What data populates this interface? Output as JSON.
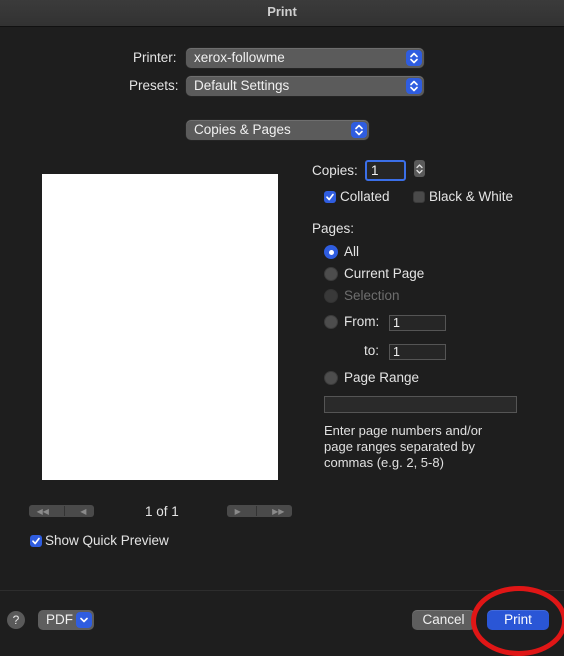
{
  "window": {
    "title": "Print"
  },
  "printer": {
    "label": "Printer:",
    "value": "xerox-followme"
  },
  "presets": {
    "label": "Presets:",
    "value": "Default Settings"
  },
  "section": {
    "value": "Copies & Pages"
  },
  "copies": {
    "label": "Copies:",
    "value": "1"
  },
  "collated": {
    "label": "Collated",
    "checked": true
  },
  "bw": {
    "label": "Black & White",
    "checked": false
  },
  "pages": {
    "label": "Pages:",
    "all": "All",
    "current": "Current Page",
    "selection": "Selection",
    "from_label": "From:",
    "from_value": "1",
    "to_label": "to:",
    "to_value": "1",
    "range_label": "Page Range",
    "range_value": "",
    "hint": "Enter page numbers and/or page ranges separated by commas (e.g. 2, 5-8)",
    "selected": "All"
  },
  "preview": {
    "page_indicator": "1 of 1",
    "show_quick_preview": "Show Quick Preview",
    "show_checked": true
  },
  "footer": {
    "help": "?",
    "pdf": "PDF",
    "cancel": "Cancel",
    "print": "Print"
  },
  "colors": {
    "accent": "#2a56d6",
    "annotation": "#e01616"
  },
  "icons": {
    "popup_stepper": "chevron-up-down-icon",
    "checkmark": "checkmark-icon",
    "first": "first-page-icon",
    "prev": "previous-page-icon",
    "next": "next-page-icon",
    "last": "last-page-icon",
    "pdf_menu": "chevron-down-icon"
  }
}
